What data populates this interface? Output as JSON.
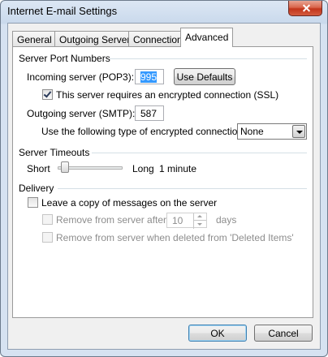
{
  "window": {
    "title": "Internet E-mail Settings"
  },
  "tabs": [
    {
      "label": "General"
    },
    {
      "label": "Outgoing Server"
    },
    {
      "label": "Connection"
    },
    {
      "label": "Advanced"
    }
  ],
  "server_ports": {
    "heading": "Server Port Numbers",
    "incoming_label": "Incoming server (POP3):",
    "incoming_value": "995",
    "use_defaults_label": "Use Defaults",
    "ssl_checkbox_label": "This server requires an encrypted connection (SSL)",
    "ssl_checked": true,
    "outgoing_label": "Outgoing server (SMTP):",
    "outgoing_value": "587",
    "encryption_label": "Use the following type of encrypted connection:",
    "encryption_value": "None"
  },
  "timeouts": {
    "heading": "Server Timeouts",
    "short_label": "Short",
    "long_label": "Long",
    "value_label": "1 minute",
    "slider_fraction": 0.05
  },
  "delivery": {
    "heading": "Delivery",
    "leave_copy_label": "Leave a copy of messages on the server",
    "leave_copy_checked": false,
    "remove_after_label": "Remove from server after",
    "remove_after_value": "10",
    "days_label": "days",
    "remove_deleted_label": "Remove from server when deleted from 'Deleted Items'"
  },
  "buttons": {
    "ok": "OK",
    "cancel": "Cancel"
  }
}
